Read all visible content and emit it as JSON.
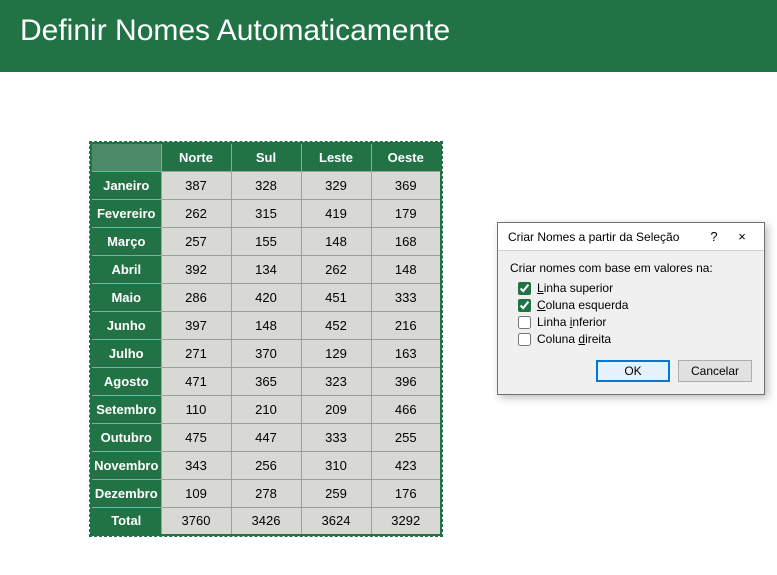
{
  "banner": {
    "title": "Definir Nomes Automaticamente"
  },
  "table": {
    "columns": [
      "Norte",
      "Sul",
      "Leste",
      "Oeste"
    ],
    "rows": [
      {
        "label": "Janeiro",
        "values": [
          387,
          328,
          329,
          369
        ]
      },
      {
        "label": "Fevereiro",
        "values": [
          262,
          315,
          419,
          179
        ]
      },
      {
        "label": "Março",
        "values": [
          257,
          155,
          148,
          168
        ]
      },
      {
        "label": "Abril",
        "values": [
          392,
          134,
          262,
          148
        ]
      },
      {
        "label": "Maio",
        "values": [
          286,
          420,
          451,
          333
        ]
      },
      {
        "label": "Junho",
        "values": [
          397,
          148,
          452,
          216
        ]
      },
      {
        "label": "Julho",
        "values": [
          271,
          370,
          129,
          163
        ]
      },
      {
        "label": "Agosto",
        "values": [
          471,
          365,
          323,
          396
        ]
      },
      {
        "label": "Setembro",
        "values": [
          110,
          210,
          209,
          466
        ]
      },
      {
        "label": "Outubro",
        "values": [
          475,
          447,
          333,
          255
        ]
      },
      {
        "label": "Novembro",
        "values": [
          343,
          256,
          310,
          423
        ]
      },
      {
        "label": "Dezembro",
        "values": [
          109,
          278,
          259,
          176
        ]
      }
    ],
    "total": {
      "label": "Total",
      "values": [
        3760,
        3426,
        3624,
        3292
      ]
    }
  },
  "dialog": {
    "title": "Criar Nomes a partir da Seleção",
    "help": "?",
    "close": "×",
    "prompt": "Criar nomes com base em valores na:",
    "options": [
      {
        "pre": "L",
        "rest": "inha superior",
        "checked": true
      },
      {
        "pre": "C",
        "rest": "oluna esquerda",
        "checked": true
      },
      {
        "pre": "",
        "rest": "Linha inferior",
        "ul_index": 6,
        "checked": false
      },
      {
        "pre": "",
        "rest": "Coluna direita",
        "ul_index": 7,
        "checked": false
      }
    ],
    "ok": "OK",
    "cancel": "Cancelar"
  }
}
